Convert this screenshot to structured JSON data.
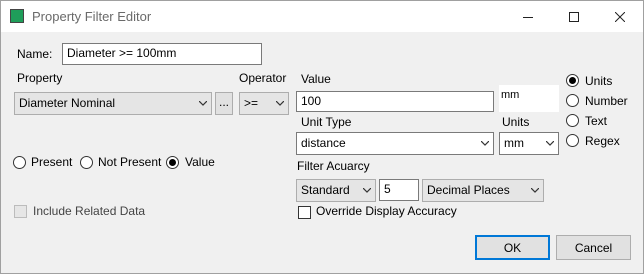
{
  "window": {
    "title": "Property Filter Editor",
    "minimize_icon": "minimize-icon",
    "maximize_icon": "maximize-icon",
    "close_icon": "close-icon",
    "app_icon": "app-icon"
  },
  "name": {
    "label": "Name:",
    "value": "Diameter >= 100mm"
  },
  "property": {
    "label": "Property",
    "selected": "Diameter Nominal",
    "browse_label": "..."
  },
  "operator": {
    "label": "Operator",
    "selected": ">="
  },
  "value": {
    "label": "Value",
    "input": "100",
    "unit_suffix": "mm"
  },
  "unit_type": {
    "label": "Unit Type",
    "selected": "distance"
  },
  "units": {
    "label": "Units",
    "selected": "mm"
  },
  "presence": {
    "options": [
      {
        "label": "Present",
        "checked": false
      },
      {
        "label": "Not Present",
        "checked": false
      },
      {
        "label": "Value",
        "checked": true
      }
    ]
  },
  "value_kind": {
    "options": [
      {
        "label": "Units",
        "checked": true
      },
      {
        "label": "Number",
        "checked": false
      },
      {
        "label": "Text",
        "checked": false
      },
      {
        "label": "Regex",
        "checked": false
      }
    ]
  },
  "accuracy": {
    "label": "Filter Acuarcy",
    "mode": "Standard",
    "digits": "5",
    "places": "Decimal Places",
    "override_label": "Override Display Accuracy",
    "override_checked": false
  },
  "include_related": {
    "label": "Include Related Data",
    "checked": false,
    "enabled": false
  },
  "buttons": {
    "ok": "OK",
    "cancel": "Cancel"
  },
  "colors": {
    "accent": "#0078d7",
    "app_icon": "#1f9e5a"
  }
}
